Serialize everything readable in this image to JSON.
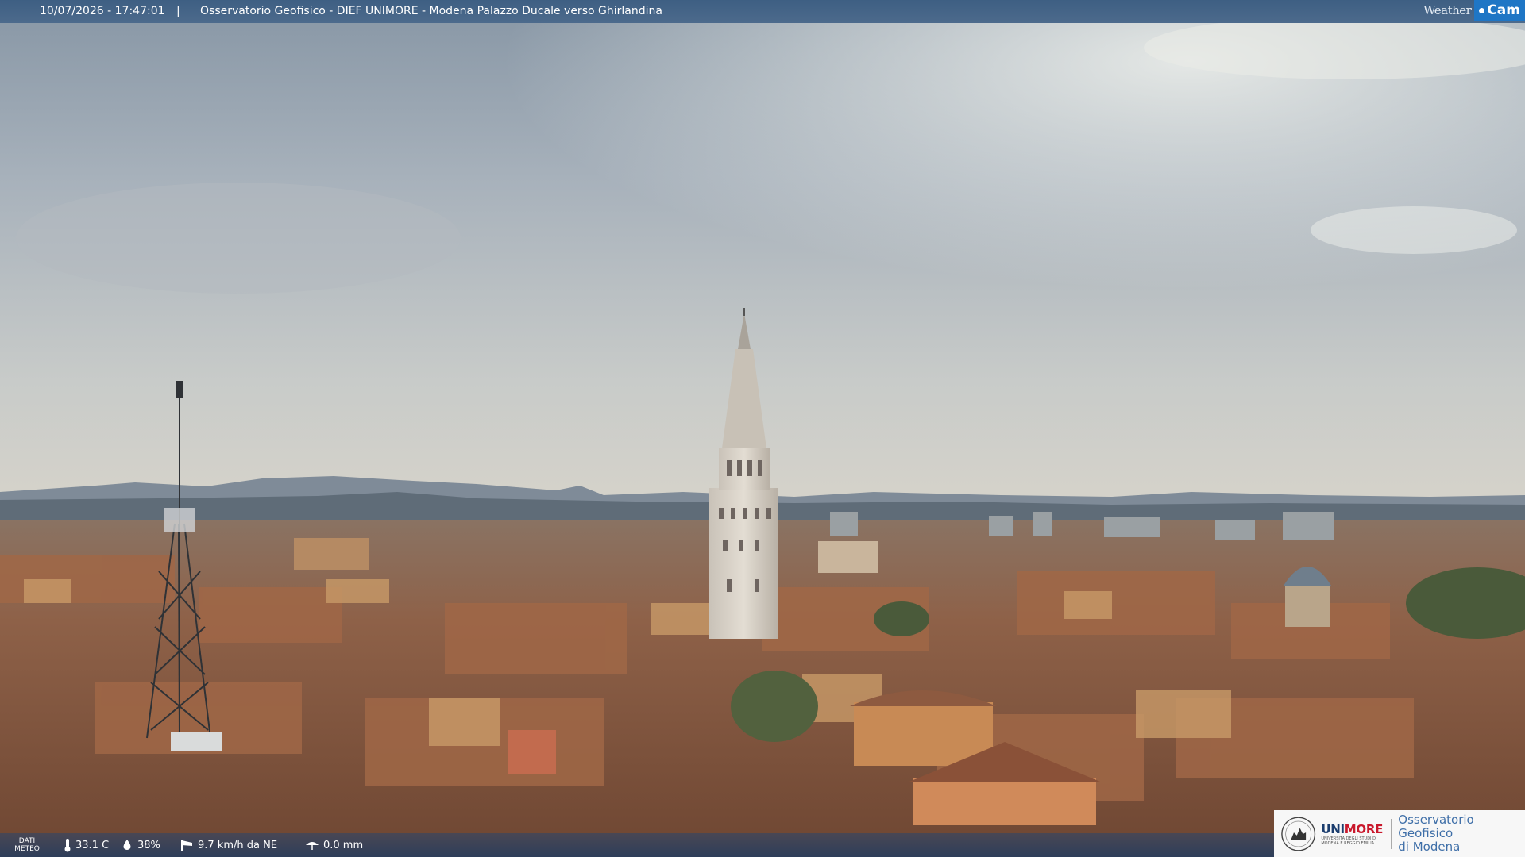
{
  "header": {
    "datetime": "10/07/2026 - 17:47:01",
    "separator": "|",
    "title": "Osservatorio Geofisico - DIEF UNIMORE - Modena Palazzo Ducale verso Ghirlandina"
  },
  "brand": {
    "weather_label": "Weather",
    "cam_label": "Cam",
    "accent_color": "#1f76c5"
  },
  "weather": {
    "dati_label_1": "DATI",
    "dati_label_2": "METEO",
    "temperature": "33.1 C",
    "humidity": "38%",
    "wind": "9.7 km/h da NE",
    "rain": "0.0 mm"
  },
  "institution": {
    "name_prefix": "UNI",
    "name_suffix": "MORE",
    "subtitle": "UNIVERSITÀ DEGLI STUDI DI MODENA E REGGIO EMILIA",
    "observatory_line1": "Osservatorio Geofisico",
    "observatory_line2": "di Modena",
    "brand_color": "#c9182c"
  }
}
